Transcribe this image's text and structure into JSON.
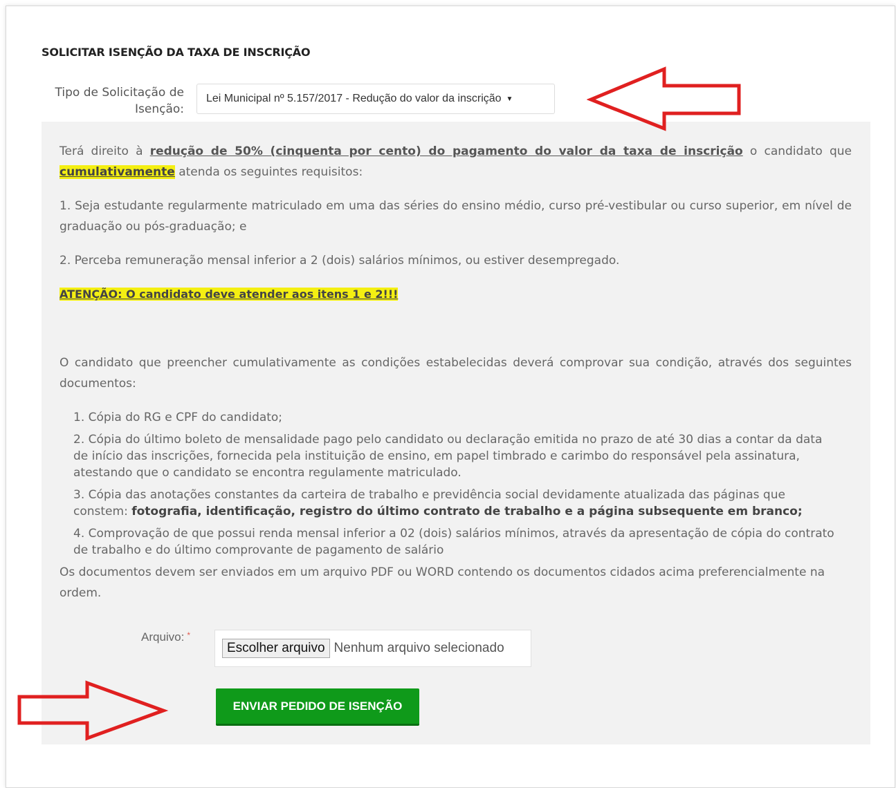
{
  "form": {
    "title": "SOLICITAR ISENÇÃO DA TAXA DE INSCRIÇÃO",
    "type_label": "Tipo de Solicitação de Isenção:",
    "type_selected": "Lei Municipal nº 5.157/2017 - Redução do valor da inscrição"
  },
  "info": {
    "p1_start": "Terá direito à ",
    "p1_emph": "redução de 50% (cinquenta por cento) do pagamento do valor da taxa de inscrição",
    "p1_mid": " o candidato que",
    "p1_hl": "cumulativamente",
    "p1_end": " atenda os seguintes requisitos:",
    "req1": "1. Seja estudante regularmente matriculado em uma das séries do ensino médio, curso pré-vestibular ou curso superior, em nível de graduação ou pós-graduação; e",
    "req2": "2. Perceba remuneração mensal inferior a 2 (dois) salários mínimos, ou estiver desempregado.",
    "attention": "ATENÇÃO: O candidato deve atender aos itens 1 e 2!!!",
    "docs_intro": "O candidato que preencher cumulativamente as condições estabelecidas deverá comprovar sua condição, através dos seguintes documentos:",
    "doc1": "1. Cópia do RG e CPF do candidato;",
    "doc2": "2. Cópia do último boleto de mensalidade pago pelo candidato ou declaração emitida no prazo de até 30 dias a contar da data de início das inscrições, fornecida pela instituição de ensino, em papel timbrado e carimbo do responsável pela assinatura, atestando que o candidato se encontra regulamente matriculado.",
    "doc3_start": "3. Cópia das anotações constantes da carteira de trabalho e previdência social devidamente atualizada das páginas que constem: ",
    "doc3_bold": "fotografia, identificação, registro do último contrato de trabalho e a página subsequente em branco;",
    "doc4": "4. Comprovação de que possui renda mensal inferior a 02 (dois) salários mínimos, através da apresentação de cópia do contrato de trabalho e do último comprovante de pagamento de salário",
    "docs_note": "Os documentos devem ser enviados em um arquivo PDF ou WORD contendo os documentos cidados acima preferencialmente na ordem."
  },
  "upload": {
    "label": "Arquivo:",
    "required_mark": "*",
    "choose_button": "Escolher arquivo",
    "status": "Nenhum arquivo selecionado"
  },
  "submit": {
    "label": "ENVIAR PEDIDO DE ISENÇÃO"
  },
  "annotations": {
    "arrow_color": "#e02020"
  }
}
